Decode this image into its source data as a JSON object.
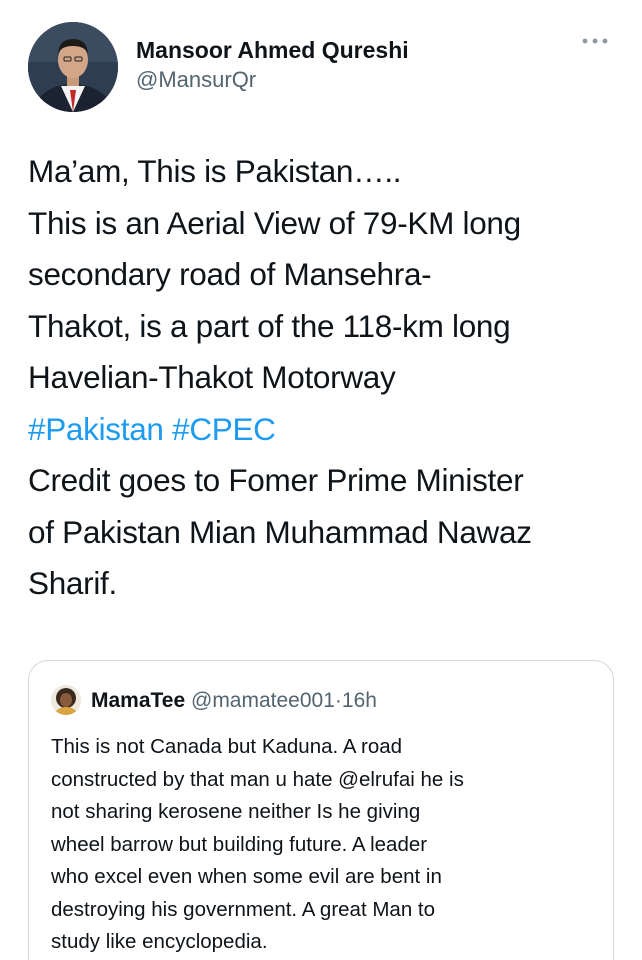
{
  "author": {
    "display_name": "Mansoor Ahmed Qureshi",
    "handle": "@MansurQr"
  },
  "more_icon": "more-dots-icon",
  "tweet": {
    "lines": [
      {
        "text": "Ma’am, This is Pakistan….."
      },
      {
        "text": "This is an Aerial View of 79-KM long"
      },
      {
        "text": "secondary road of Mansehra-"
      },
      {
        "text": "Thakot, is a part of the 118-km long"
      },
      {
        "text": "Havelian-Thakot Motorway"
      },
      {
        "hashtag1": "#Pakistan",
        "hashtag2": "#CPEC"
      },
      {
        "text": "Credit goes to Fomer Prime Minister"
      },
      {
        "text": "of Pakistan Mian Muhammad Nawaz"
      },
      {
        "text": "Sharif."
      }
    ]
  },
  "quote": {
    "name": "MamaTee",
    "handle": "@mamatee001",
    "separator": "·",
    "time": "16h",
    "lines": [
      "This is not Canada but Kaduna. A road",
      "constructed by that man u hate @elrufai he is",
      "not sharing kerosene neither Is he giving",
      "wheel barrow but building future. A leader",
      "who excel even when some evil are bent in",
      "destroying his government. A great Man to",
      "study like encyclopedia."
    ]
  },
  "colors": {
    "link": "#1d9bf0",
    "secondary_text": "#536471",
    "primary_text": "#0f1419",
    "border": "#cfd9de"
  }
}
